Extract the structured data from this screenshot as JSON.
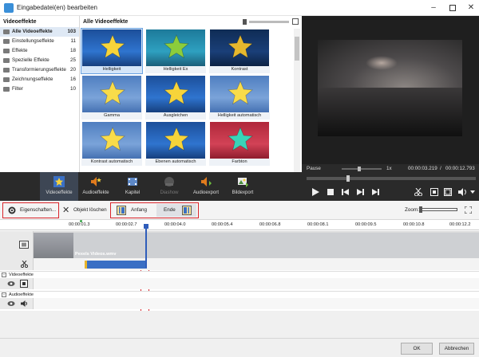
{
  "window": {
    "title": "Eingabedatei(en) bearbeiten",
    "controls": [
      "minimize-icon",
      "maximize-icon",
      "close-icon"
    ]
  },
  "categories": {
    "header": "Videoeffekte",
    "items": [
      {
        "label": "Alle Videoeffekte",
        "count": "103",
        "selected": true
      },
      {
        "label": "Einstellungseffekte",
        "count": "11"
      },
      {
        "label": "Effekte",
        "count": "18"
      },
      {
        "label": "Spezielle Effekte",
        "count": "25"
      },
      {
        "label": "Transformierungseffekte",
        "count": "20"
      },
      {
        "label": "Zeichnungseffekte",
        "count": "16"
      },
      {
        "label": "Filter",
        "count": "10"
      }
    ]
  },
  "effects_grid": {
    "header": "Alle Videoeffekte",
    "tiles": [
      {
        "label": "Helligkeit",
        "style": "yellow-star-blue",
        "selected": true
      },
      {
        "label": "Helligkeit Ex",
        "style": "green-star-teal"
      },
      {
        "label": "Kontrast",
        "style": "yellow-star-dark"
      },
      {
        "label": "Gamma",
        "style": "yellow-star-light"
      },
      {
        "label": "Ausgleichen",
        "style": "yellow-star-blue"
      },
      {
        "label": "Helligkeit automatisch",
        "style": "yellow-star-light"
      },
      {
        "label": "Kontrast automatisch",
        "style": "yellow-star-light"
      },
      {
        "label": "Ebenen automatisch",
        "style": "yellow-star-blue"
      },
      {
        "label": "Farbton",
        "style": "teal-star-red"
      }
    ]
  },
  "preview": {
    "state": "Pause",
    "speed": "1x",
    "current_time": "00:00:03.219",
    "separator": "/",
    "total_time": "00:00:12.793"
  },
  "toolbar": {
    "items": [
      {
        "label": "Videoeffekte",
        "icon": "star-film-icon",
        "selected": true
      },
      {
        "label": "Audioeffekte",
        "icon": "speaker-star-icon"
      },
      {
        "label": "Kapitel",
        "icon": "film-icon"
      },
      {
        "label": "Diashow",
        "icon": "slideshow-icon",
        "disabled": true
      },
      {
        "label": "Audioexport",
        "icon": "speaker-export-icon"
      },
      {
        "label": "Bildexport",
        "icon": "image-export-icon"
      }
    ]
  },
  "actions": {
    "properties_label": "Eigenschaften...",
    "delete_label": "Objekt löschen",
    "start_label": "Anfang",
    "end_label": "Ende",
    "zoom_label": "Zoom:"
  },
  "ruler": {
    "ticks": [
      "00:00:01.3",
      "00:00:02.7",
      "00:00:04.0",
      "00:00:05.4",
      "00:00:06.8",
      "00:00:08.1",
      "00:00:09.5",
      "00:00:10.8",
      "00:00:12.2"
    ]
  },
  "timeline": {
    "clip_name": "Pexels Videos.wmv",
    "section_video_effects": "Videoeffekte",
    "section_audio_effects": "Audioeffekte"
  },
  "dialog": {
    "ok_label": "OK",
    "cancel_label": "Abbrechen"
  },
  "colors": {
    "accent_blue": "#3a6fc4",
    "highlight_red": "#d9242a",
    "toolbar_dark": "#2a2a2a",
    "playhead": "#2f5dba"
  }
}
